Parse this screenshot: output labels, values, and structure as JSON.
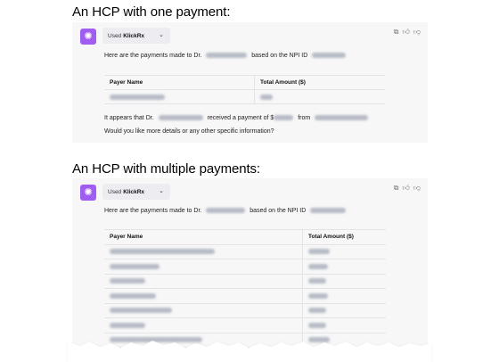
{
  "sections": [
    {
      "heading": "An HCP with one payment:",
      "plugin": {
        "used_text": "Used",
        "name": "KlickRx"
      },
      "message": {
        "intro_prefix": "Here are the payments made to Dr.",
        "intro_middle": "based on the NPI ID",
        "table_headers": [
          "Payer Name",
          "Total Amount ($)"
        ],
        "row_count": 1,
        "conclusion_prefix": "It appears that Dr.",
        "conclusion_middle": "received a payment of $",
        "conclusion_from": "from",
        "followup": "Would you like more details or any other specific information?"
      }
    },
    {
      "heading": "An HCP with multiple payments:",
      "plugin": {
        "used_text": "Used",
        "name": "KlickRx"
      },
      "message": {
        "intro_prefix": "Here are the payments made to Dr.",
        "intro_middle": "based on the NPI ID",
        "table_headers": [
          "Payer Name",
          "Total Amount ($)"
        ],
        "row_count": 7
      }
    }
  ],
  "icons": {
    "avatar": "openai-logo-icon",
    "dropdown": "chevron-down-icon",
    "copy": "copy-icon",
    "thumbs_up": "thumbs-up-icon",
    "thumbs_down": "thumbs-down-icon"
  },
  "colors": {
    "avatar_bg": "#a05ef0",
    "panel_bg": "#f7f7f8",
    "pill_bg": "#ececf1",
    "redaction": "#b8bcc6"
  }
}
